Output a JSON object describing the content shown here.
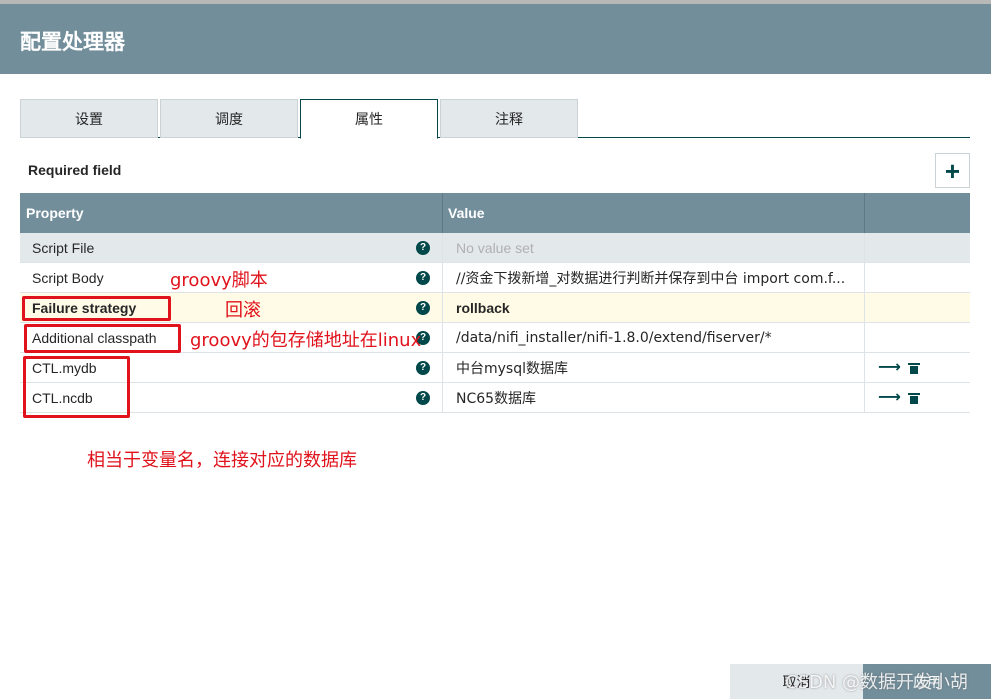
{
  "dialog": {
    "title": "配置处理器"
  },
  "tabs": [
    {
      "label": "设置"
    },
    {
      "label": "调度"
    },
    {
      "label": "属性"
    },
    {
      "label": "注释"
    }
  ],
  "required_label": "Required field",
  "add_button": "+",
  "table": {
    "headers": {
      "property": "Property",
      "value": "Value"
    },
    "rows": [
      {
        "property": "Script File",
        "value": "No value set"
      },
      {
        "property": "Script Body",
        "value": "//资金下拨新增_对数据进行判断并保存到中台 import com.f..."
      },
      {
        "property": "Failure strategy",
        "value": "rollback"
      },
      {
        "property": "Additional classpath",
        "value": "/data/nifi_installer/nifi-1.8.0/extend/fiserver/*"
      },
      {
        "property": "CTL.mydb",
        "value": "中台mysql数据库"
      },
      {
        "property": "CTL.ncdb",
        "value": "NC65数据库"
      }
    ]
  },
  "annotations": {
    "script_body": "groovy脚本",
    "failure_strategy": "回滚",
    "classpath": "groovy的包存储地址在linux",
    "ctl": "相当于变量名，连接对应的数据库"
  },
  "footer": {
    "cancel": "取消",
    "apply": "应用"
  },
  "watermark": "CSDN @数据开发小胡",
  "colors": {
    "header": "#728e9b",
    "accent": "#004849",
    "annotation": "#e0121b"
  }
}
